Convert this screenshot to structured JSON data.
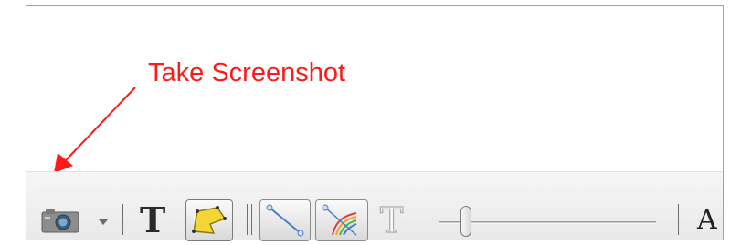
{
  "annotation": {
    "label": "Take Screenshot",
    "color": "#ff1a1a"
  },
  "toolbar": {
    "screenshot_button": {
      "icon": "camera-icon"
    },
    "screenshot_dropdown": {
      "icon": "dropdown-arrow-icon"
    },
    "text_bold_tool": {
      "icon": "text-bold-icon",
      "glyph": "T"
    },
    "shape_tool": {
      "icon": "yellow-shape-icon",
      "selected": true
    },
    "line_tool": {
      "icon": "line-icon"
    },
    "gradient_line_tool": {
      "icon": "rainbow-line-icon"
    },
    "text_outline_tool": {
      "icon": "text-outline-icon",
      "glyph": "T"
    },
    "size_slider": {
      "level": 0.12
    },
    "font_tool": {
      "glyph": "A"
    }
  }
}
